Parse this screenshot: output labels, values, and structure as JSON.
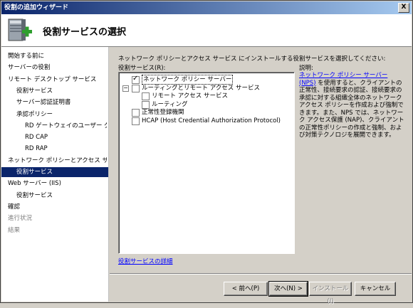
{
  "window": {
    "title": "役割の追加ウィザード",
    "close_glyph": "X"
  },
  "header": {
    "title": "役割サービスの選択",
    "icon": "server-add-icon"
  },
  "nav": [
    {
      "label": "開始する前に",
      "state": "normal",
      "indent": 0
    },
    {
      "label": "サーバーの役割",
      "state": "normal",
      "indent": 0
    },
    {
      "label": "リモート デスクトップ サービス",
      "state": "normal",
      "indent": 0
    },
    {
      "label": "役割サービス",
      "state": "normal",
      "indent": 1
    },
    {
      "label": "サーバー認証証明書",
      "state": "normal",
      "indent": 1
    },
    {
      "label": "承認ポリシー",
      "state": "normal",
      "indent": 1
    },
    {
      "label": "RD ゲートウェイのユーザー グ...",
      "state": "normal",
      "indent": 2
    },
    {
      "label": "RD CAP",
      "state": "normal",
      "indent": 2
    },
    {
      "label": "RD RAP",
      "state": "normal",
      "indent": 2
    },
    {
      "label": "ネットワーク ポリシーとアクセス サービ...",
      "state": "normal",
      "indent": 0
    },
    {
      "label": "役割サービス",
      "state": "selected",
      "indent": 1
    },
    {
      "label": "Web サーバー (IIS)",
      "state": "normal",
      "indent": 0
    },
    {
      "label": "役割サービス",
      "state": "normal",
      "indent": 1
    },
    {
      "label": "確認",
      "state": "normal",
      "indent": 0
    },
    {
      "label": "進行状況",
      "state": "disabled",
      "indent": 0
    },
    {
      "label": "結果",
      "state": "disabled",
      "indent": 0
    }
  ],
  "content": {
    "instruction": "ネットワーク ポリシーとアクセス サービス にインストールする役割サービスを選択してください:",
    "roles_label": "役割サービス(R):",
    "tree": [
      {
        "label": "ネットワーク ポリシー サーバー",
        "checked": true,
        "indent": 1,
        "expander": "",
        "highlighted": true
      },
      {
        "label": "ルーティングとリモート アクセス サービス",
        "checked": false,
        "indent": 1,
        "expander": "−",
        "highlighted": false
      },
      {
        "label": "リモート アクセス サービス",
        "checked": false,
        "indent": 2,
        "expander": "",
        "highlighted": false
      },
      {
        "label": "ルーティング",
        "checked": false,
        "indent": 2,
        "expander": "",
        "highlighted": false
      },
      {
        "label": "正常性登録機関",
        "checked": false,
        "indent": 1,
        "expander": "",
        "highlighted": false
      },
      {
        "label": "HCAP (Host Credential Authorization Protocol)",
        "checked": false,
        "indent": 1,
        "expander": "",
        "highlighted": false
      }
    ],
    "description_label": "説明:",
    "description_link": "ネットワーク ポリシー サーバー (NPS)",
    "description_text": " を使用すると、クライアントの正常性、接続要求の認証、接続要求の承認に対する組織全体のネットワーク アクセス ポリシーを作成および強制できます。また、NPS では、ネットワーク アクセス保護 (NAP)、クライアントの正常性ポリシーの作成と強制、および対策テクノロジを展開できます。",
    "details_link": "役割サービスの詳細"
  },
  "buttons": {
    "back": "< 前へ(P)",
    "next": "次へ(N) >",
    "install": "インストール(I)",
    "cancel": "キャンセル"
  },
  "colors": {
    "selection": "#0a246a",
    "link": "#0000ff",
    "chrome": "#d4d0c8"
  }
}
